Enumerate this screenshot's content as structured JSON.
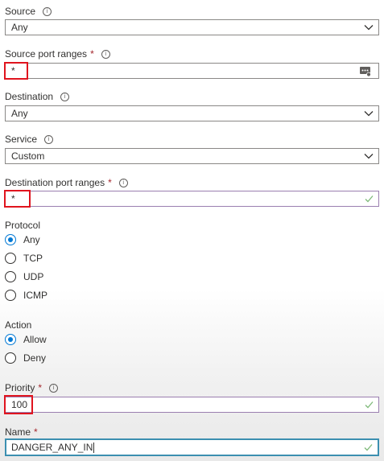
{
  "source": {
    "label": "Source",
    "value": "Any"
  },
  "source_port_ranges": {
    "label": "Source port ranges",
    "required_mark": "*",
    "value": "*"
  },
  "destination": {
    "label": "Destination",
    "value": "Any"
  },
  "service": {
    "label": "Service",
    "value": "Custom"
  },
  "destination_port_ranges": {
    "label": "Destination port ranges",
    "required_mark": "*",
    "value": "*"
  },
  "protocol": {
    "label": "Protocol",
    "options": [
      "Any",
      "TCP",
      "UDP",
      "ICMP"
    ],
    "selected": "Any"
  },
  "action": {
    "label": "Action",
    "options": [
      "Allow",
      "Deny"
    ],
    "selected": "Allow"
  },
  "priority": {
    "label": "Priority",
    "required_mark": "*",
    "value": "100"
  },
  "name": {
    "label": "Name",
    "required_mark": "*",
    "value": "DANGER_ANY_IN"
  },
  "info_glyph": "i",
  "colors": {
    "accent": "#0078d4",
    "highlight": "#e0141e",
    "required": "#a4262c",
    "valid_check": "#7fba7a"
  },
  "icons": [
    "info-icon",
    "chevron-down-icon",
    "ellipsis-field-icon",
    "checkmark-icon"
  ]
}
